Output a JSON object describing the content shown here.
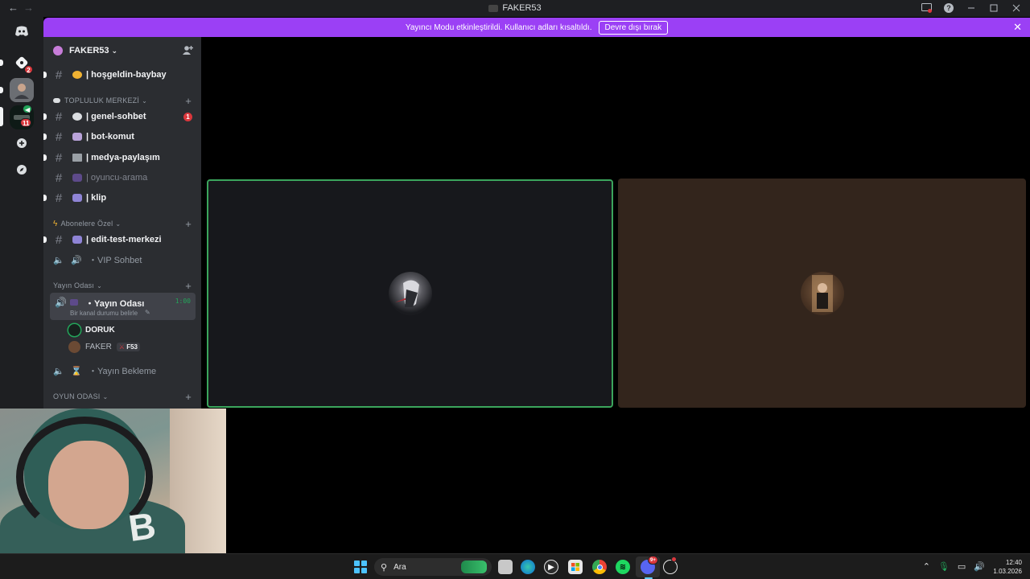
{
  "window": {
    "title": "FAKER53",
    "nav_back": "←",
    "nav_forward": "→"
  },
  "banner": {
    "message": "Yayıncı Modu etkinleştirildi. Kullanıcı adları kısaltıldı.",
    "button_label": "Devre dışı bırak",
    "close_label": "✕"
  },
  "rail": {
    "badges": [
      "2",
      "11"
    ]
  },
  "server": {
    "name": "FAKER53",
    "chevron": "⌄"
  },
  "channels": {
    "welcome": "| hoşgeldin-baybay",
    "cat_community": "TOPLULUK MERKEZİ",
    "general": "| genel-sohbet",
    "general_badge": "1",
    "bot": "| bot-komut",
    "media": "| medya-paylaşım",
    "player": "| oyuncu-arama",
    "clip": "| klip",
    "cat_subscribers": "Abonelere Özel",
    "edit": "| edit-test-merkezi",
    "vip": "・VIP Sohbet",
    "cat_stream": "Yayın Odası",
    "stream_room": "・Yayın Odası",
    "stream_status": "Bir kanal durumu belirle",
    "stream_timer": "1:00",
    "user_1": "DORUK",
    "user_2": "FAKER",
    "user_2_tag": "F53",
    "stream_wait": "・Yayın Bekleme",
    "cat_game": "OYUN ODASI"
  },
  "taskbar": {
    "search_placeholder": "Ara",
    "time": "12:40",
    "date": "1.03.2026",
    "discord_badge": "9+"
  },
  "colors": {
    "accent_banner": "#9b40f5",
    "speaking_ring": "#3ba55c",
    "mention_badge": "#da373c"
  }
}
